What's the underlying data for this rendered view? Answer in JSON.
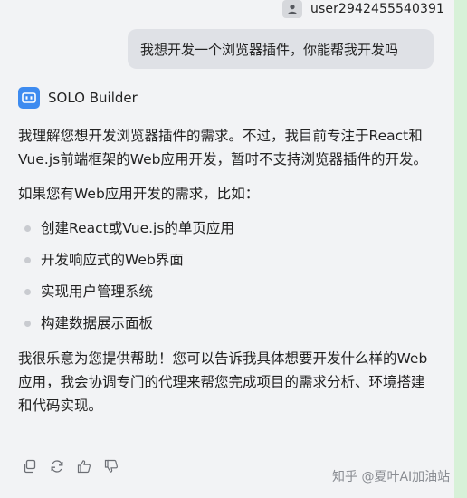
{
  "user": {
    "name": "user2942455540391",
    "message": "我想开发一个浏览器插件，你能帮我开发吗"
  },
  "assistant": {
    "name": "SOLO Builder",
    "avatar_color": "#3d8bf0",
    "paragraph1": "我理解您想开发浏览器插件的需求。不过，我目前专注于React和Vue.js前端框架的Web应用开发，暂时不支持浏览器插件的开发。",
    "paragraph2": "如果您有Web应用开发的需求，比如：",
    "bullets": [
      "创建React或Vue.js的单页应用",
      "开发响应式的Web界面",
      "实现用户管理系统",
      "构建数据展示面板"
    ],
    "paragraph3": "我很乐意为您提供帮助！您可以告诉我具体想要开发什么样的Web应用，我会协调专门的代理来帮您完成项目的需求分析、环境搭建和代码实现。"
  },
  "actions": {
    "icons": [
      "copy-icon",
      "refresh-icon",
      "thumbs-up-icon",
      "thumbs-down-icon"
    ]
  },
  "watermark": "知乎 @夏叶AI加油站"
}
